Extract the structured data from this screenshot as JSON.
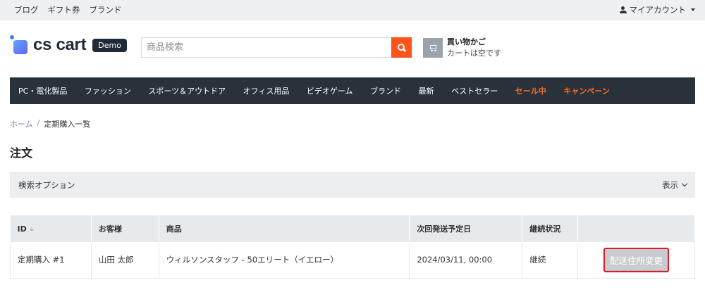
{
  "topbar": {
    "links": [
      "ブログ",
      "ギフト券",
      "ブランド"
    ],
    "account_label": "マイアカウント"
  },
  "header": {
    "logo_text": "cs cart",
    "demo_badge": "Demo",
    "search_placeholder": "商品検索",
    "cart_title": "買い物かご",
    "cart_status": "カートは空です"
  },
  "nav": {
    "items": [
      "PC・電化製品",
      "ファッション",
      "スポーツ＆アウトドア",
      "オフィス用品",
      "ビデオゲーム",
      "ブランド",
      "最新",
      "ベストセラー"
    ],
    "highlight_items": [
      "セール中",
      "キャンペーン"
    ]
  },
  "breadcrumb": {
    "home": "ホーム",
    "separator": "/",
    "current": "定期購入一覧"
  },
  "page_title": "注文",
  "search_options": {
    "label": "検索オプション",
    "toggle_label": "表示"
  },
  "table": {
    "columns": [
      "ID",
      "お客様",
      "商品",
      "次回発送予定日",
      "継続状況",
      ""
    ],
    "rows": [
      {
        "id": "定期購入 #1",
        "customer": "山田 太郎",
        "product": "ウィルソンスタッフ - 50エリート（イエロー）",
        "next_date": "2024/03/11, 00:00",
        "status": "継続",
        "action_label": "配送住所変更"
      }
    ]
  },
  "colors": {
    "accent": "#ff5319",
    "nav_bg": "#29323b",
    "highlight": "#ff6a1f",
    "button_border": "#d81e2a"
  }
}
